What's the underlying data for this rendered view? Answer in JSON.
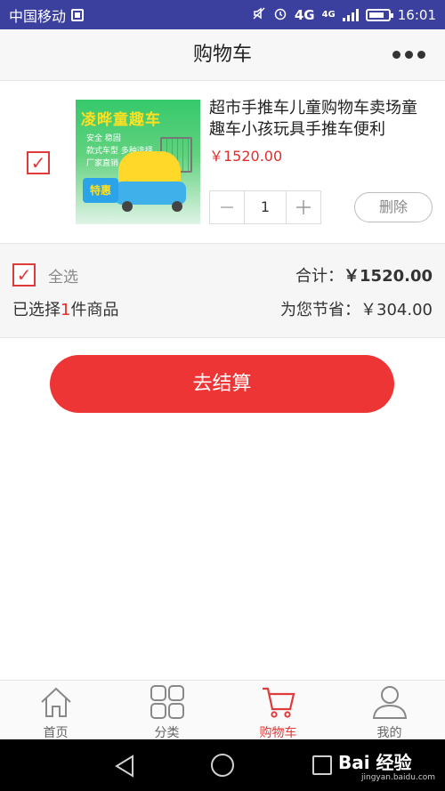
{
  "status_bar": {
    "carrier": "中国移动",
    "network": "4G",
    "network2": "4G",
    "time": "16:01"
  },
  "header": {
    "title": "购物车"
  },
  "cart_item": {
    "image_title": "凌晔童趣车",
    "image_lines": [
      "安全  稳固",
      "款式车型  多种选择",
      "厂家直销  品质保证"
    ],
    "image_badge": "特惠",
    "name": "超市手推车儿童购物车卖场童趣车小孩玩具手推车便利",
    "price": "￥1520.00",
    "quantity": "1",
    "delete_label": "删除",
    "checked": true
  },
  "summary": {
    "select_all_label": "全选",
    "total_label": "合计：",
    "total_amount": "￥1520.00",
    "selected_prefix": "已选择",
    "selected_num": "1",
    "selected_suffix": "件商品",
    "saving_label": "为您节省：",
    "saving_amount": "￥304.00"
  },
  "checkout": {
    "label": "去结算"
  },
  "tabs": [
    {
      "label": "首页",
      "icon": "home-icon",
      "active": false
    },
    {
      "label": "分类",
      "icon": "category-icon",
      "active": false
    },
    {
      "label": "购物车",
      "icon": "cart-icon",
      "active": true
    },
    {
      "label": "我的",
      "icon": "user-icon",
      "active": false
    }
  ],
  "watermark": {
    "text": "Bai 经验",
    "sub": "jingyan.baidu.com"
  },
  "colors": {
    "accent": "#ee3535",
    "status_bar": "#3b3f9e",
    "price": "#e02d2d"
  }
}
